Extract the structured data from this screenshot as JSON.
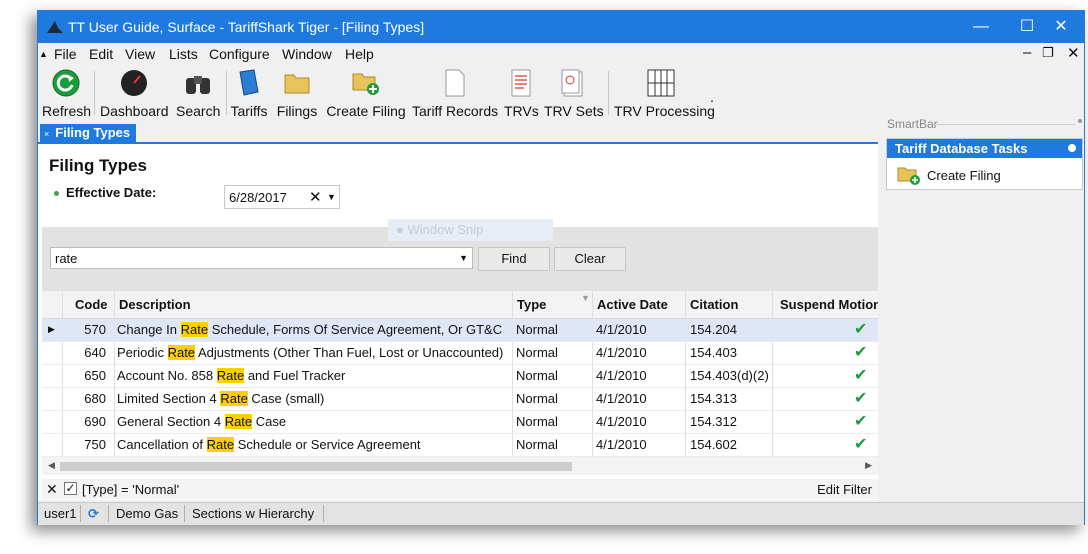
{
  "window": {
    "title": "TT User Guide, Surface - TariffShark Tiger - [Filing Types]"
  },
  "menu": [
    "File",
    "Edit",
    "View",
    "Lists",
    "Configure",
    "Window",
    "Help"
  ],
  "toolbar": {
    "refresh": "Refresh",
    "dashboard": "Dashboard",
    "search": "Search",
    "tariffs": "Tariffs",
    "filings": "Filings",
    "create_filing": "Create Filing",
    "tariff_records": "Tariff Records",
    "trvs": "TRVs",
    "trv_sets": "TRV Sets",
    "trv_processing": "TRV Processing"
  },
  "tab": {
    "label": "Filing Types"
  },
  "page": {
    "title": "Filing Types",
    "effective_label": "Effective Date:",
    "effective_date": "6/28/2017",
    "ghost_label": "Window Snip"
  },
  "search": {
    "value": "rate",
    "find_label": "Find",
    "clear_label": "Clear"
  },
  "grid": {
    "columns": [
      "Code",
      "Description",
      "Type",
      "Active Date",
      "Citation",
      "Suspend Motion"
    ],
    "rows": [
      {
        "code": "570",
        "pre": "Change In ",
        "match": "Rate",
        "post": " Schedule, Forms Of Service Agreement, Or  GT&C",
        "type": "Normal",
        "active": "4/1/2010",
        "citation": "154.204"
      },
      {
        "code": "640",
        "pre": "Periodic ",
        "match": "Rate",
        "post": " Adjustments (Other Than Fuel, Lost or Unaccounted)",
        "type": "Normal",
        "active": "4/1/2010",
        "citation": "154.403"
      },
      {
        "code": "650",
        "pre": "Account No. 858 ",
        "match": "Rate",
        "post": " and Fuel Tracker",
        "type": "Normal",
        "active": "4/1/2010",
        "citation": "154.403(d)(2)"
      },
      {
        "code": "680",
        "pre": "Limited Section 4 ",
        "match": "Rate",
        "post": " Case (small)",
        "type": "Normal",
        "active": "4/1/2010",
        "citation": "154.313"
      },
      {
        "code": "690",
        "pre": "General Section 4 ",
        "match": "Rate",
        "post": " Case",
        "type": "Normal",
        "active": "4/1/2010",
        "citation": "154.312"
      },
      {
        "code": "750",
        "pre": "Cancellation of ",
        "match": "Rate",
        "post": " Schedule or Service Agreement",
        "type": "Normal",
        "active": "4/1/2010",
        "citation": "154.602"
      }
    ]
  },
  "filter": {
    "expression": "[Type] = 'Normal'",
    "edit_label": "Edit Filter"
  },
  "smartbar": {
    "title": "SmartBar",
    "section": "Tariff Database Tasks",
    "item": "Create Filing"
  },
  "status": {
    "user": "user1",
    "db": "Demo Gas",
    "mode": "Sections w Hierarchy"
  }
}
